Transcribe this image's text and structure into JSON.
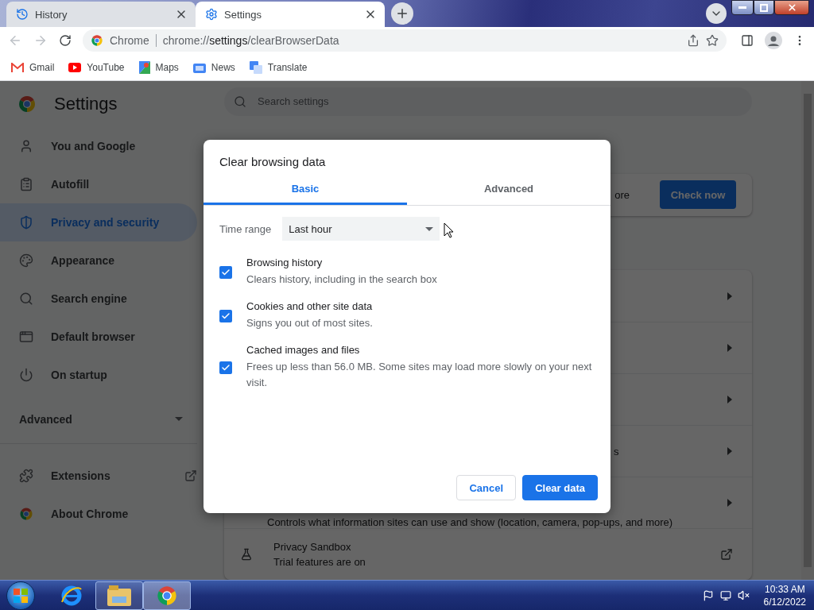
{
  "browser": {
    "tabs": [
      {
        "title": "History",
        "selected": false
      },
      {
        "title": "Settings",
        "selected": true
      }
    ],
    "omnibox": {
      "site": "Chrome",
      "url_scheme": "chrome://",
      "url_host": "settings",
      "url_path": "/clearBrowserData"
    },
    "bookmarks": [
      {
        "label": "Gmail"
      },
      {
        "label": "YouTube"
      },
      {
        "label": "Maps"
      },
      {
        "label": "News"
      },
      {
        "label": "Translate"
      }
    ]
  },
  "settings": {
    "title": "Settings",
    "search_placeholder": "Search settings",
    "nav": [
      {
        "label": "You and Google",
        "selected": false
      },
      {
        "label": "Autofill",
        "selected": false
      },
      {
        "label": "Privacy and security",
        "selected": true
      },
      {
        "label": "Appearance",
        "selected": false
      },
      {
        "label": "Search engine",
        "selected": false
      },
      {
        "label": "Default browser",
        "selected": false
      },
      {
        "label": "On startup",
        "selected": false
      }
    ],
    "advanced": {
      "label": "Advanced",
      "expanded": false
    },
    "nav_bottom": [
      {
        "label": "Extensions"
      },
      {
        "label": "About Chrome"
      }
    ],
    "safety_check": {
      "text": "ore",
      "button": "Check now"
    },
    "rows": [
      {
        "kind": "arrow"
      },
      {
        "kind": "arrow"
      },
      {
        "kind": "arrow"
      },
      {
        "kind": "arrow",
        "title": "s"
      },
      {
        "kind": "arrow",
        "subtitle": "Controls what information sites can use and show (location, camera, pop-ups, and more)"
      },
      {
        "kind": "external",
        "title": "Privacy Sandbox",
        "subtitle": "Trial features are on"
      }
    ]
  },
  "dialog": {
    "title": "Clear browsing data",
    "tabs": [
      {
        "label": "Basic",
        "selected": true
      },
      {
        "label": "Advanced",
        "selected": false
      }
    ],
    "time_range": {
      "label": "Time range",
      "value": "Last hour"
    },
    "items": [
      {
        "title": "Browsing history",
        "description": "Clears history, including in the search box",
        "checked": true
      },
      {
        "title": "Cookies and other site data",
        "description": "Signs you out of most sites.",
        "checked": true
      },
      {
        "title": "Cached images and files",
        "description": "Frees up less than 56.0 MB. Some sites may load more slowly on your next visit.",
        "checked": true
      }
    ],
    "buttons": [
      {
        "label": "Cancel",
        "kind": "secondary"
      },
      {
        "label": "Clear data",
        "kind": "primary"
      }
    ]
  },
  "taskbar": {
    "time": "10:33 AM",
    "date": "6/12/2022"
  }
}
